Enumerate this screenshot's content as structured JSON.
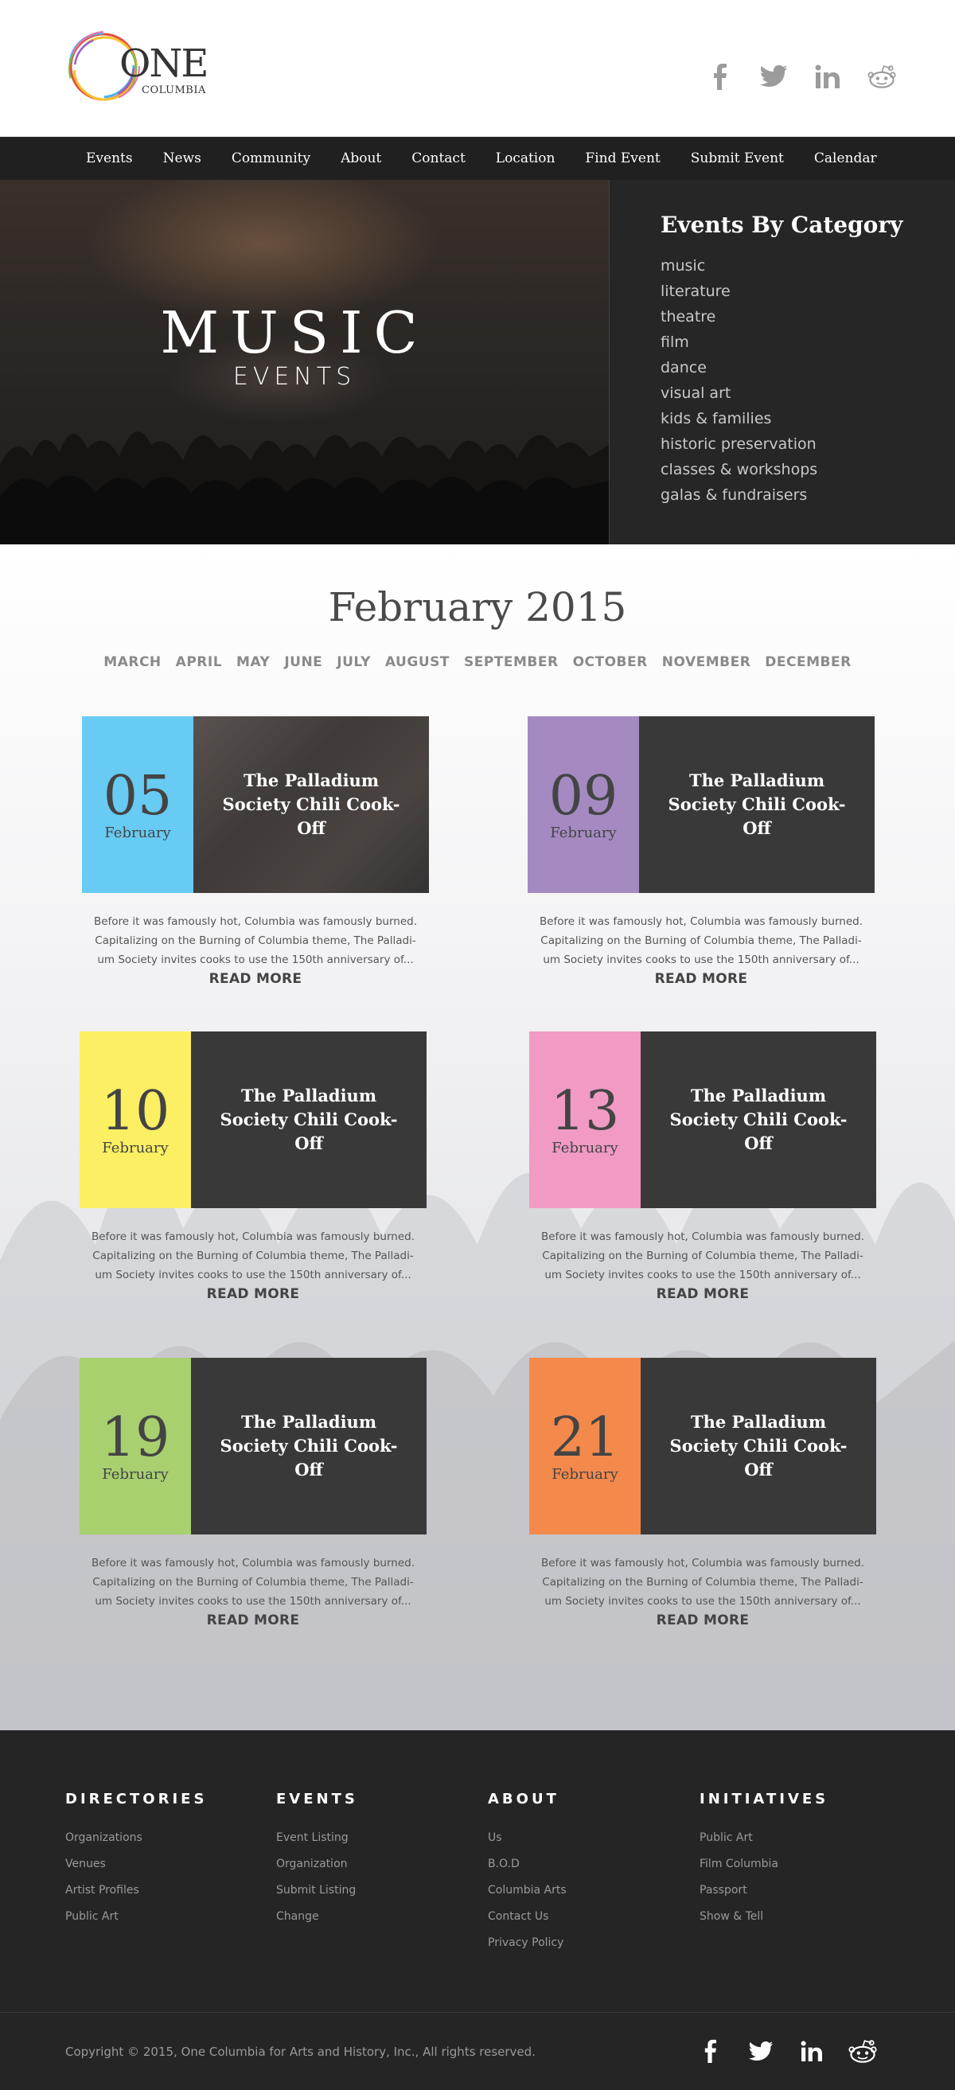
{
  "logo": {
    "word": "ONE",
    "sub": "COLUMBIA"
  },
  "header_social": [
    "facebook-icon",
    "twitter-icon",
    "linkedin-icon",
    "reddit-icon"
  ],
  "nav": [
    "Events",
    "News",
    "Community",
    "About",
    "Contact",
    "Location",
    "Find Event",
    "Submit Event",
    "Calendar"
  ],
  "hero": {
    "title": "MUSIC",
    "subtitle": "EVENTS"
  },
  "categories": {
    "title": "Events By Category",
    "items": [
      "music",
      "literature",
      "theatre",
      "film",
      "dance",
      "visual art",
      "kids & families",
      "historic preservation",
      "classes & workshops",
      "galas & fundraisers"
    ]
  },
  "month": {
    "title": "February 2015",
    "others": [
      "MARCH",
      "APRIL",
      "MAY",
      "JUNE",
      "JULY",
      "AUGUST",
      "SEPTEMBER",
      "OCTOBER",
      "NOVEMBER",
      "DECEMBER"
    ]
  },
  "events": [
    {
      "day": "05",
      "month": "February",
      "title": "The Palladium Society Chili Cook-Off",
      "desc": "Before it was famously hot, Columbia was famously burned. Capitalizing on the Burning of Columbia theme, The Palladi-um Society invites cooks to use the 150th anniversary of...",
      "read_more": "READ MORE",
      "color": "#67cbf3"
    },
    {
      "day": "09",
      "month": "February",
      "title": "The Palladium Society Chili Cook-Off",
      "desc": "Before it was famously hot, Columbia was famously burned. Capitalizing on the Burning of Columbia theme, The Palladi-um Society invites cooks to use the 150th anniversary of...",
      "read_more": "READ MORE",
      "color": "#a58ac2"
    },
    {
      "day": "10",
      "month": "February",
      "title": "The Palladium Society Chili Cook-Off",
      "desc": "Before it was famously hot, Columbia was famously burned. Capitalizing on the Burning of Columbia theme, The Palladi-um Society invites cooks to use the 150th anniversary of...",
      "read_more": "READ MORE",
      "color": "#fcef63"
    },
    {
      "day": "13",
      "month": "February",
      "title": "The Palladium Society Chili Cook-Off",
      "desc": "Before it was famously hot, Columbia was famously burned. Capitalizing on the Burning of Columbia theme, The Palladi-um Society invites cooks to use the 150th anniversary of...",
      "read_more": "READ MORE",
      "color": "#f09ac4"
    },
    {
      "day": "19",
      "month": "February",
      "title": "The Palladium Society Chili Cook-Off",
      "desc": "Before it was famously hot, Columbia was famously burned. Capitalizing on the Burning of Columbia theme, The Palladi-um Society invites cooks to use the 150th anniversary of...",
      "read_more": "READ MORE",
      "color": "#a8d06f"
    },
    {
      "day": "21",
      "month": "February",
      "title": "The Palladium Society Chili Cook-Off",
      "desc": "Before it was famously hot, Columbia was famously burned. Capitalizing on the Burning of Columbia theme, The Palladi-um Society invites cooks to use the 150th anniversary of...",
      "read_more": "READ MORE",
      "color": "#f4894c"
    }
  ],
  "footer": {
    "columns": [
      {
        "title": "DIRECTORIES",
        "links": [
          "Organizations",
          "Venues",
          "Artist Profiles",
          "Public Art"
        ]
      },
      {
        "title": "EVENTS",
        "links": [
          "Event Listing",
          "Organization",
          "Submit Listing",
          "Change"
        ]
      },
      {
        "title": "ABOUT",
        "links": [
          "Us",
          "B.O.D",
          "Columbia Arts",
          "Contact Us",
          "Privacy Policy"
        ]
      },
      {
        "title": "INITIATIVES",
        "links": [
          "Public Art",
          "Film Columbia",
          "Passport",
          "Show & Tell"
        ]
      }
    ],
    "copyright": "Copyright © 2015, One Columbia for Arts and History, Inc., All rights reserved."
  }
}
